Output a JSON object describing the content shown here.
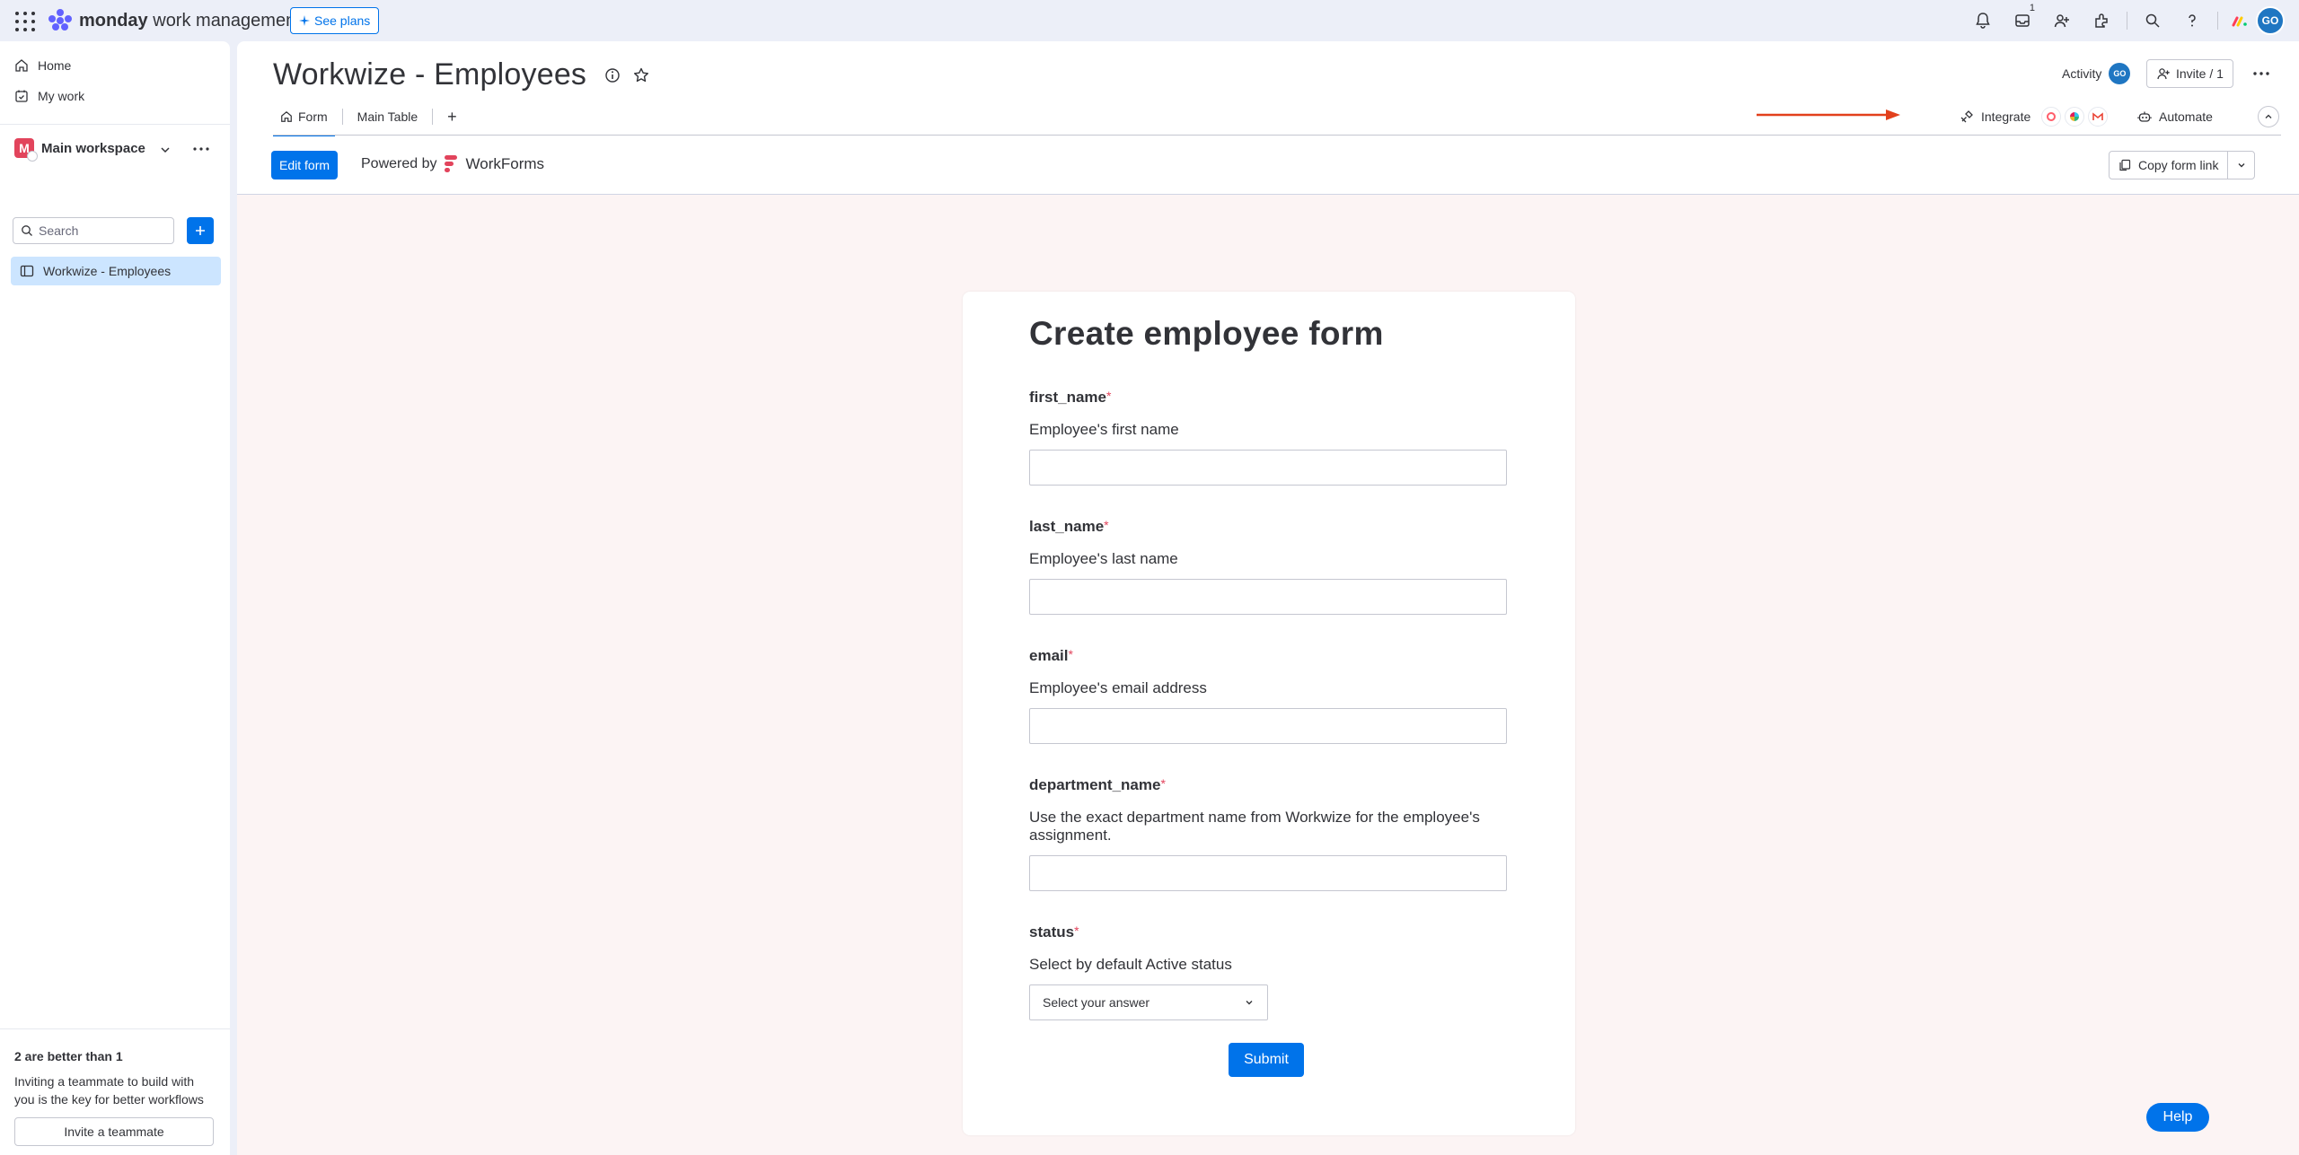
{
  "topbar": {
    "brand_bold": "monday",
    "brand_rest": " work management",
    "see_plans": "See plans",
    "notification_count": "1",
    "avatar_initials": "GO"
  },
  "sidebar": {
    "home": "Home",
    "my_work": "My work",
    "workspace_initial": "M",
    "workspace_name": "Main workspace",
    "search_placeholder": "Search",
    "board_item": "Workwize - Employees",
    "promo_title": "2 are better than 1",
    "promo_text": "Inviting a teammate to build with you is the key for better workflows",
    "promo_button": "Invite a teammate"
  },
  "board": {
    "title": "Workwize - Employees",
    "activity_label": "Activity",
    "activity_avatar": "GO",
    "invite_label": "Invite / 1",
    "tabs": [
      {
        "label": "Form"
      },
      {
        "label": "Main Table"
      }
    ],
    "tab_add": "+",
    "integrate_label": "Integrate",
    "automate_label": "Automate",
    "edit_form": "Edit form",
    "powered_by": "Powered by",
    "workforms_name": "WorkForms",
    "copy_form_link": "Copy form link"
  },
  "form": {
    "title": "Create employee form",
    "required_mark": "*",
    "questions": [
      {
        "label": "first_name",
        "description": "Employee's first name"
      },
      {
        "label": "last_name",
        "description": "Employee's last name"
      },
      {
        "label": "email",
        "description": "Employee's email address"
      },
      {
        "label": "department_name",
        "description": "Use the exact department name from Workwize for the employee's assignment."
      },
      {
        "label": "status",
        "description": "Select by default Active status",
        "placeholder": "Select your answer"
      }
    ],
    "submit": "Submit"
  },
  "help": "Help",
  "colors": {
    "primary": "#0073ea",
    "required": "#e2445c",
    "arrow": "#e2401c",
    "form_background": "#fcf4f4"
  }
}
